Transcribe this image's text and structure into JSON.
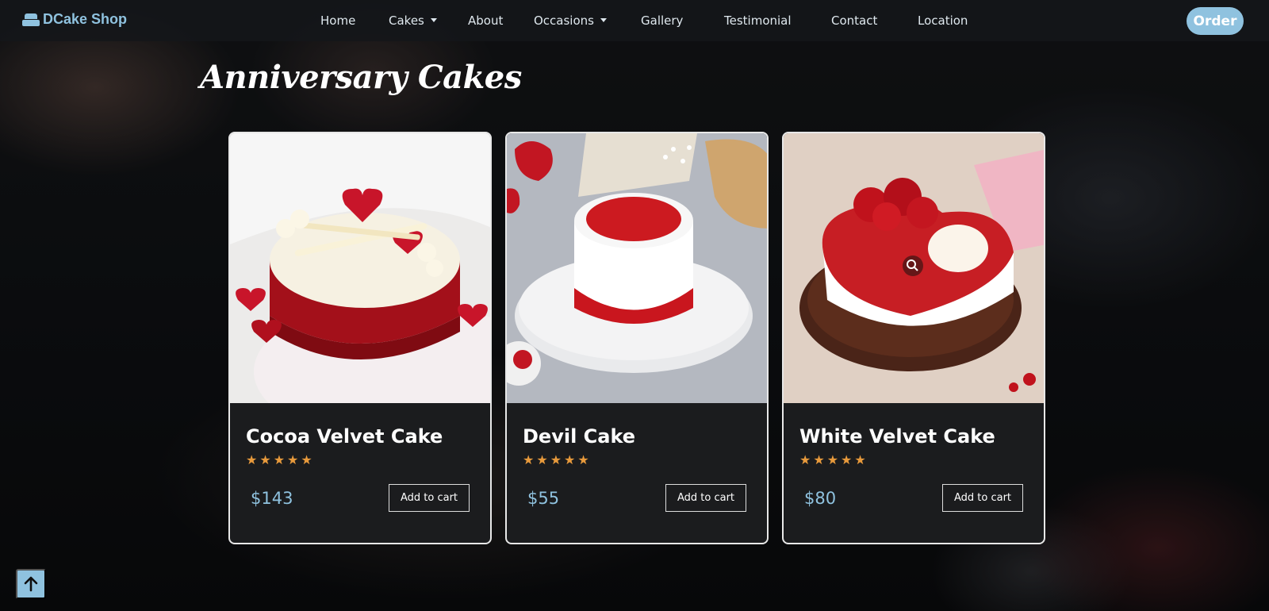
{
  "brand": {
    "name": "DCake Shop",
    "icon": "cake-icon"
  },
  "nav": {
    "links": [
      {
        "label": "Home"
      },
      {
        "label": "Cakes",
        "dropdown": true
      },
      {
        "label": "About"
      },
      {
        "label": "Occasions",
        "dropdown": true
      },
      {
        "label": "Gallery"
      },
      {
        "label": "Testimonial"
      },
      {
        "label": "Contact"
      },
      {
        "label": "Location"
      }
    ],
    "order_label": "Order"
  },
  "page": {
    "title": "Anniversary Cakes"
  },
  "products": [
    {
      "name": "Cocoa Velvet Cake",
      "price": "$143",
      "rating": 5,
      "cart_label": "Add to cart"
    },
    {
      "name": "Devil Cake",
      "price": "$55",
      "rating": 5,
      "cart_label": "Add to cart"
    },
    {
      "name": "White Velvet Cake",
      "price": "$80",
      "rating": 5,
      "cart_label": "Add to cart"
    }
  ],
  "scroll_top": {
    "icon": "arrow-up-icon"
  },
  "colors": {
    "accent": "#8fc2df",
    "star": "#e89a3c",
    "card_bg": "#1b1c1e"
  }
}
